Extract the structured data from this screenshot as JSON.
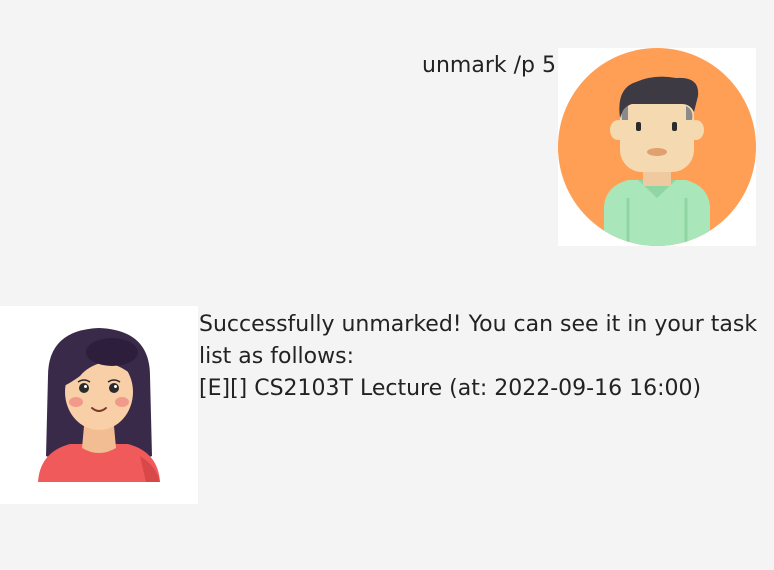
{
  "conversation": {
    "user_message": {
      "text": "unmark /p 5",
      "avatar": "man-avatar-icon"
    },
    "bot_message": {
      "lines": [
        "Successfully unmarked! You can see it in your task",
        "list as follows:",
        "[E][] CS2103T Lecture (at: 2022-09-16 16:00)"
      ],
      "avatar": "woman-avatar-icon"
    }
  },
  "colors": {
    "background": "#f4f4f4",
    "user_avatar_circle": "#ff9f55",
    "user_shirt": "#a9e6b9",
    "bot_shirt": "#f05a5a",
    "hair_dark": "#3a2a4a"
  }
}
